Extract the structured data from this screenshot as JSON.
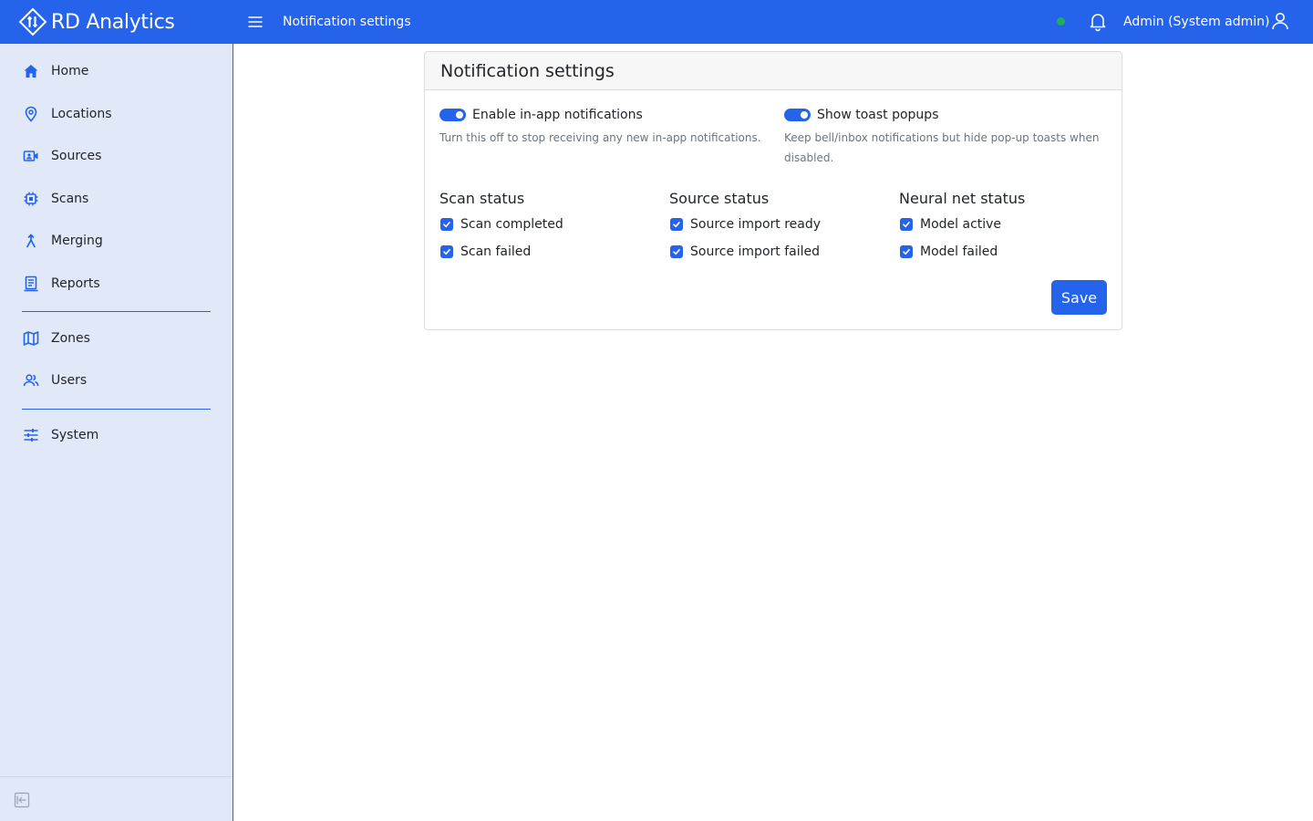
{
  "app": {
    "brand_name": "RD Analytics"
  },
  "header": {
    "page_title": "Notification settings",
    "user_label": "Admin (System admin)",
    "status_color": "#1fb254"
  },
  "sidebar": {
    "items": [
      {
        "label": "Home",
        "icon": "home-icon"
      },
      {
        "label": "Locations",
        "icon": "map-pin-icon"
      },
      {
        "label": "Sources",
        "icon": "video-camera-icon"
      },
      {
        "label": "Scans",
        "icon": "chip-icon"
      },
      {
        "label": "Merging",
        "icon": "merge-icon"
      },
      {
        "label": "Reports",
        "icon": "report-icon"
      },
      {
        "label": "Zones",
        "icon": "map-icon"
      },
      {
        "label": "Users",
        "icon": "users-icon"
      },
      {
        "label": "System",
        "icon": "sliders-icon"
      }
    ]
  },
  "card": {
    "title": "Notification settings",
    "toggles": [
      {
        "label": "Enable in-app notifications",
        "description": "Turn this off to stop receiving any new in-app notifications.",
        "on": true
      },
      {
        "label": "Show toast popups",
        "description": "Keep bell/inbox notifications but hide pop-up toasts when disabled.",
        "on": true
      }
    ],
    "groups": [
      {
        "title": "Scan status",
        "options": [
          {
            "label": "Scan completed",
            "checked": true
          },
          {
            "label": "Scan failed",
            "checked": true
          }
        ]
      },
      {
        "title": "Source status",
        "options": [
          {
            "label": "Source import ready",
            "checked": true
          },
          {
            "label": "Source import failed",
            "checked": true
          }
        ]
      },
      {
        "title": "Neural net status",
        "options": [
          {
            "label": "Model active",
            "checked": true
          },
          {
            "label": "Model failed",
            "checked": true
          }
        ]
      }
    ],
    "save_label": "Save"
  },
  "colors": {
    "accent": "#2563eb",
    "sidebar_bg": "#e1e9f9"
  }
}
